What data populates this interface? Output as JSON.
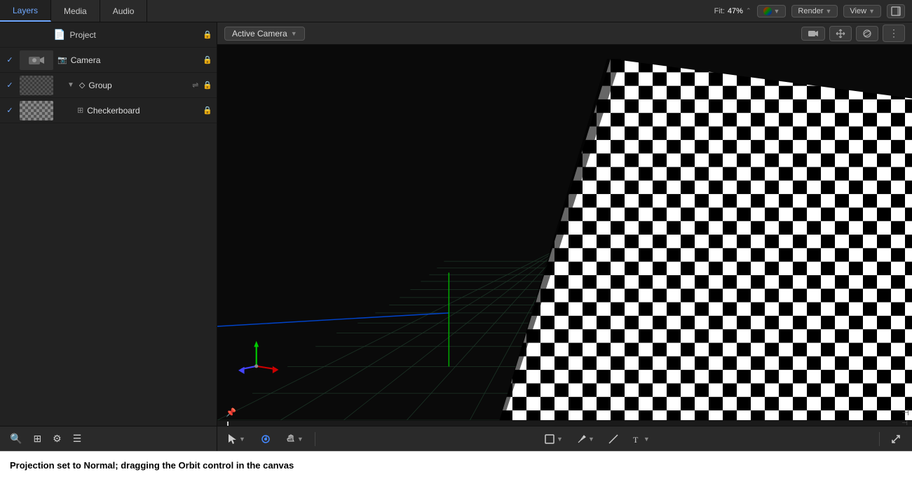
{
  "tabs": {
    "items": [
      {
        "label": "Layers",
        "active": true
      },
      {
        "label": "Media",
        "active": false
      },
      {
        "label": "Audio",
        "active": false
      }
    ]
  },
  "topbar": {
    "fit_label": "Fit:",
    "fit_value": "47%",
    "render_btn": "Render",
    "view_btn": "View"
  },
  "layers": {
    "project": {
      "name": "Project"
    },
    "camera": {
      "name": "Camera"
    },
    "group": {
      "name": "Group"
    },
    "checkerboard": {
      "name": "Checkerboard"
    }
  },
  "canvas": {
    "camera_dropdown": "Active Camera",
    "render_btn": "Render",
    "view_btn": "View"
  },
  "toolbar_bottom": {
    "tools": [
      {
        "label": "▼",
        "name": "select-tool"
      },
      {
        "label": "⊙",
        "name": "orbit-tool"
      },
      {
        "label": "✋",
        "name": "pan-tool"
      },
      {
        "label": "▼",
        "name": "pan-dropdown"
      }
    ],
    "center_tools": [
      {
        "label": "⬜▼",
        "name": "shape-tool"
      },
      {
        "label": "✏▼",
        "name": "pen-tool"
      },
      {
        "label": "/",
        "name": "line-tool"
      },
      {
        "label": "T▼",
        "name": "text-tool"
      }
    ],
    "right_tools": [
      {
        "label": "↗",
        "name": "expand-tool"
      }
    ]
  },
  "caption": "Projection set to Normal; dragging the Orbit control in the canvas",
  "sidebar_bottom": {
    "add_btn": "＋",
    "grid_btn": "⊞",
    "settings_btn": "⚙",
    "layers_btn": "☰"
  }
}
